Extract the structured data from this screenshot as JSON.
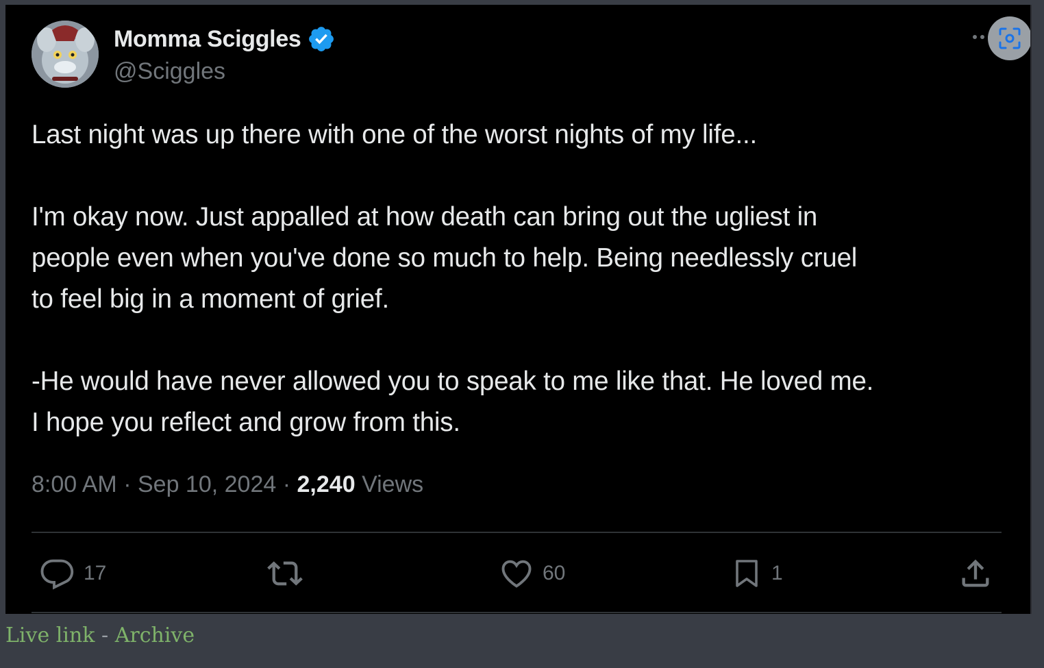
{
  "tweet": {
    "display_name": "Momma Sciggles",
    "handle": "@Sciggles",
    "body": {
      "line1": "Last night was up there with one of the worst nights of my life...",
      "line2": "I'm okay now. Just appalled at how death can bring out the ugliest in",
      "line3": "people even when you've done so much to help. Being needlessly cruel",
      "line4": "to feel big in a moment of grief.",
      "line5": "-He would have never allowed you to speak to me like that. He loved me.",
      "line6": "I hope you reflect and grow from this."
    },
    "time": "8:00 AM",
    "date": "Sep 10, 2024",
    "views_count": "2,240",
    "views_label": "Views",
    "separator": "·"
  },
  "actions": {
    "replies": "17",
    "likes": "60",
    "bookmarks": "1"
  },
  "footer_links": {
    "live_link": "Live link",
    "separator": "-",
    "archive": "Archive"
  },
  "colors": {
    "page_background": "#393d45",
    "tweet_background": "#000000",
    "primary_text": "#e7e9ea",
    "secondary_text": "#71767b",
    "verified_blue": "#1d9bf0",
    "link_green": "#7fb36a"
  },
  "icons": {
    "verified": "verified-badge-icon",
    "reply": "reply-icon",
    "retweet": "retweet-icon",
    "like": "heart-icon",
    "bookmark": "bookmark-icon",
    "share": "share-icon",
    "lens": "visual-search-icon"
  }
}
